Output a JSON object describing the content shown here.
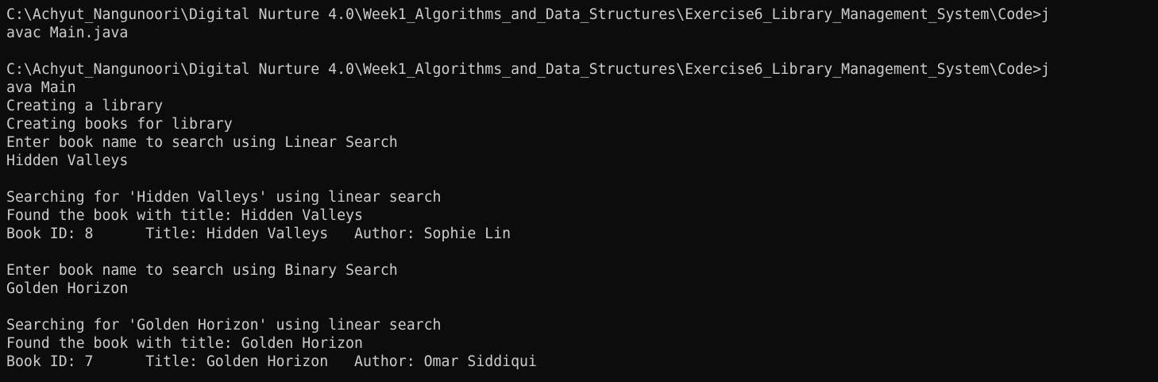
{
  "terminal": {
    "colors": {
      "background": "#0c0c0c",
      "foreground": "#cccccc"
    },
    "lines": [
      "C:\\Achyut_Nangunoori\\Digital Nurture 4.0\\Week1_Algorithms_and_Data_Structures\\Exercise6_Library_Management_System\\Code>j",
      "avac Main.java",
      "",
      "C:\\Achyut_Nangunoori\\Digital Nurture 4.0\\Week1_Algorithms_and_Data_Structures\\Exercise6_Library_Management_System\\Code>j",
      "ava Main",
      "Creating a library",
      "Creating books for library",
      "Enter book name to search using Linear Search",
      "Hidden Valleys",
      "",
      "Searching for 'Hidden Valleys' using linear search",
      "Found the book with title: Hidden Valleys",
      "Book ID: 8      Title: Hidden Valleys   Author: Sophie Lin",
      "",
      "Enter book name to search using Binary Search",
      "Golden Horizon",
      "",
      "Searching for 'Golden Horizon' using linear search",
      "Found the book with title: Golden Horizon",
      "Book ID: 7      Title: Golden Horizon   Author: Omar Siddiqui"
    ]
  }
}
